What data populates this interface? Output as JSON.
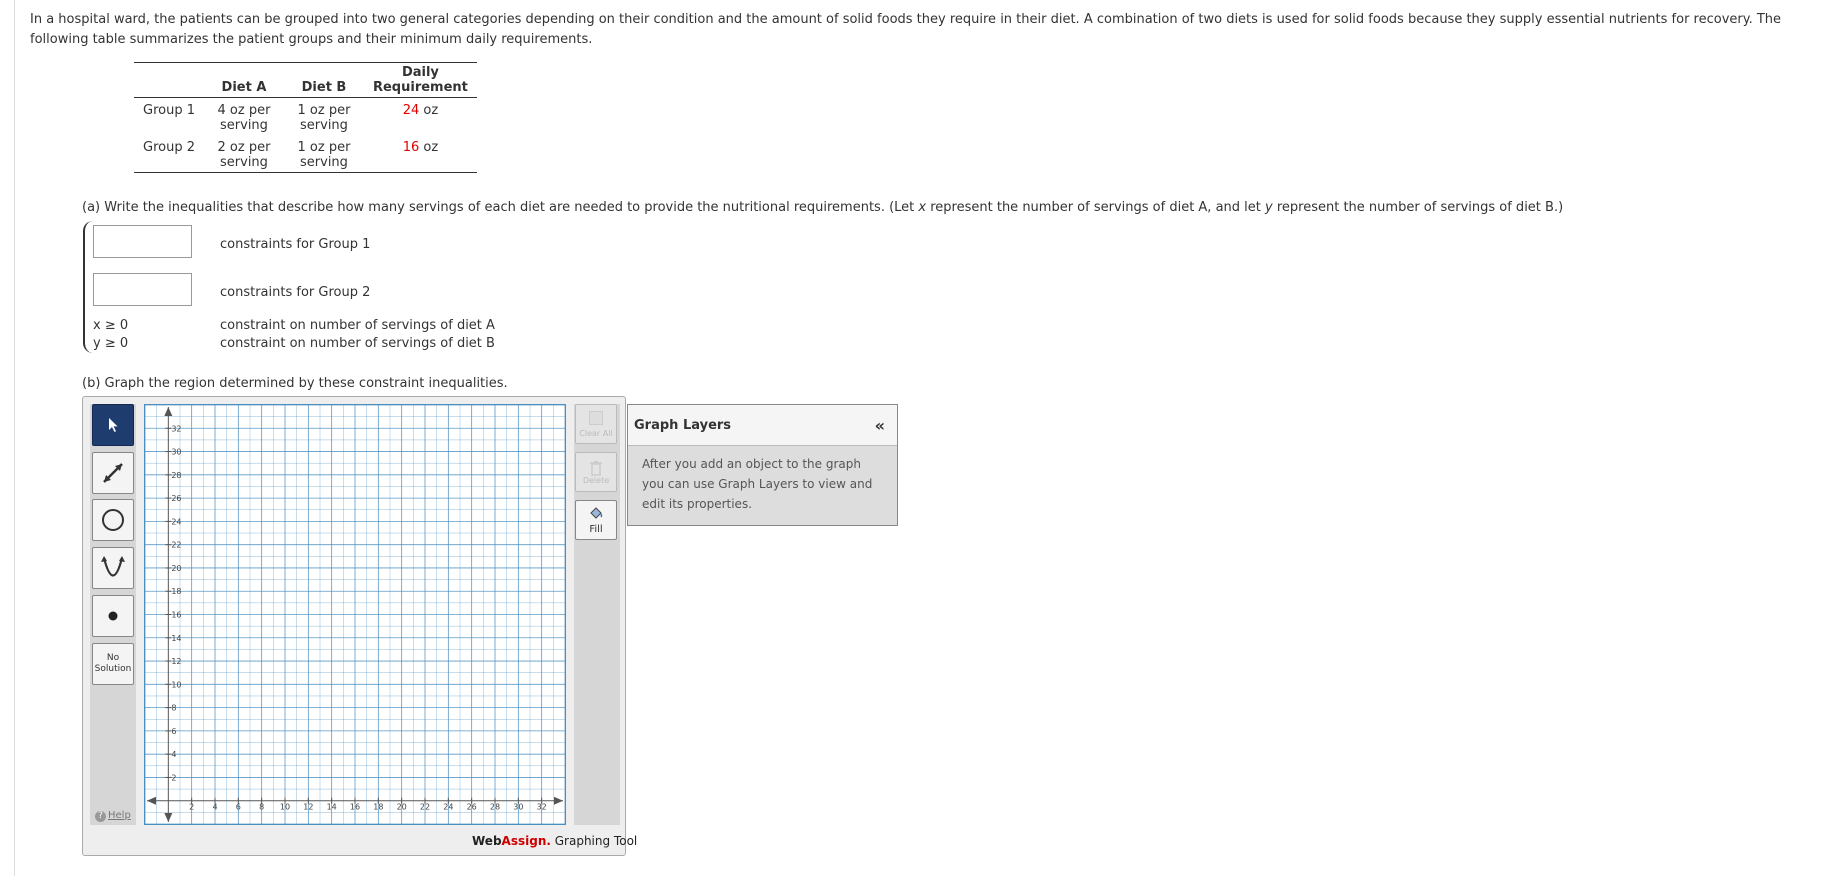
{
  "intro_text": "In a hospital ward, the patients can be grouped into two general categories depending on their condition and the amount of solid foods they require in their diet. A combination of two diets is used for solid foods because they supply essential nutrients for recovery. The following table summarizes the patient groups and their minimum daily requirements.",
  "table": {
    "headers": [
      "",
      "Diet A",
      "Diet B",
      "Daily Requirement"
    ],
    "rows": [
      {
        "group": "Group 1",
        "a": "4 oz per serving",
        "b": "1 oz per serving",
        "req_num": "24",
        "req_unit": " oz"
      },
      {
        "group": "Group 2",
        "a": "2 oz per serving",
        "b": "1 oz per serving",
        "req_num": "16",
        "req_unit": " oz"
      }
    ]
  },
  "part_a": {
    "prompt_start": "(a) Write the inequalities that describe how many servings of each diet are needed to provide the nutritional requirements. (Let ",
    "var_x": "x",
    "prompt_mid": " represent the number of servings of diet A, and let ",
    "var_y": "y",
    "prompt_end": " represent the number of servings of diet B.)",
    "group1_value": "",
    "group1_label": "constraints for Group 1",
    "group2_value": "",
    "group2_label": "constraints for Group 2",
    "x_constraint": "x ≥ 0",
    "x_label": "constraint on number of servings of diet A",
    "y_constraint": "y ≥ 0",
    "y_label": "constraint on number of servings of diet B"
  },
  "part_b": {
    "prompt": "(b) Graph the region determined by these constraint inequalities."
  },
  "tool": {
    "no_solution": "No Solution",
    "help": "Help",
    "clear_all": "Clear All",
    "delete": "Delete",
    "fill": "Fill",
    "brand_web": "Web",
    "brand_assign": "Assign.",
    "brand_suffix": " Graphing Tool",
    "layers_title": "Graph Layers",
    "layers_collapse": "«",
    "layers_text": "After you add an object to the graph you can use Graph Layers to view and edit its properties."
  },
  "graph": {
    "x_ticks": [
      "2",
      "4",
      "6",
      "8",
      "10",
      "12",
      "14",
      "16",
      "18",
      "20",
      "22",
      "24",
      "26",
      "28",
      "30",
      "32"
    ],
    "y_ticks": [
      "2",
      "4",
      "6",
      "8",
      "10",
      "12",
      "14",
      "16",
      "18",
      "20",
      "22",
      "24",
      "26",
      "28",
      "30",
      "32"
    ],
    "xlim": [
      -2,
      34
    ],
    "ylim": [
      -2,
      34
    ],
    "grid_color": "#4a8fc0"
  }
}
